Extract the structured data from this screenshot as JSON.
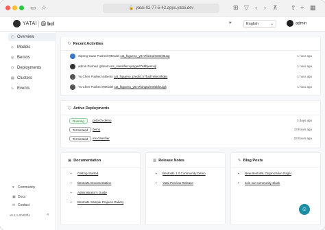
{
  "browser": {
    "url": "yatai-02-77-5-42.apps.yatai.dev",
    "nav_icons": [
      "back-icon",
      "forward-icon",
      "sidebar-icon",
      "shield-icon",
      "share-icon",
      "new-tab-icon",
      "tabs-icon"
    ]
  },
  "header": {
    "logo_text": "YATAI",
    "partner": "ⓑ bcl",
    "theme_toggle": "☀",
    "language": "English",
    "username": "admin"
  },
  "sidebar": {
    "items": [
      {
        "label": "Overview",
        "icon": "overview-icon"
      },
      {
        "label": "Models",
        "icon": "model-icon"
      },
      {
        "label": "Bentos",
        "icon": "bento-icon"
      },
      {
        "label": "Deployments",
        "icon": "deployment-icon"
      },
      {
        "label": "Clusters",
        "icon": "cluster-icon"
      },
      {
        "label": "Events",
        "icon": "events-icon"
      }
    ],
    "footer": [
      {
        "label": "Community",
        "icon": "community-icon"
      },
      {
        "label": "Docs",
        "icon": "docs-icon"
      },
      {
        "label": "Contact",
        "icon": "contact-icon"
      }
    ],
    "version": "v0.3.1-0b8f3ffa"
  },
  "recent_activities": {
    "title": "Recent Activities",
    "rows": [
      {
        "user": "Xipeng Guan",
        "action": "Pushed",
        "kind": "Model",
        "target": "cat_fsgueno_y8:n7foisnd7e8ek9usg",
        "time": "1 hour ago"
      },
      {
        "user": "admin",
        "action": "Pushed",
        "kind": "Bento",
        "target": "iris_classifier:ujsrjgwd7e9bjwsruijl",
        "time": "1 hour ago"
      },
      {
        "user": "Yu Chen",
        "action": "Pushed",
        "kind": "Bento",
        "target": "cat_fsgueno_predict:n7fuid7e8ec8hqks",
        "time": "1 hour ago"
      },
      {
        "user": "Yu Chen",
        "action": "Pushed",
        "kind": "Model",
        "target": "cat_fsgueno_y8:n7fuhq6d7e8ebfeuigk",
        "time": "1 hour ago"
      }
    ]
  },
  "active_deployments": {
    "title": "Active Deployments",
    "rows": [
      {
        "status": "Running",
        "name": "pytorch-demo",
        "time": "3 days ago"
      },
      {
        "status": "Terminated",
        "name": "demo",
        "time": "13 hours ago"
      },
      {
        "status": "Terminated",
        "name": "iris-classifier",
        "time": "23 hours ago"
      }
    ]
  },
  "documentation": {
    "title": "Documentation",
    "links": [
      "Getting Started",
      "BentoML Documentation",
      "Administrator's Guide",
      "BentoML Sample Projects Gallery"
    ]
  },
  "release_notes": {
    "title": "Release Notes",
    "links": [
      "BentoML 1.0 Community Demo",
      "Yatai Preview Release"
    ]
  },
  "blog_posts": {
    "title": "Blog Posts",
    "links": [
      "New BentoML Organization Page!",
      "Join our community Slack"
    ]
  }
}
